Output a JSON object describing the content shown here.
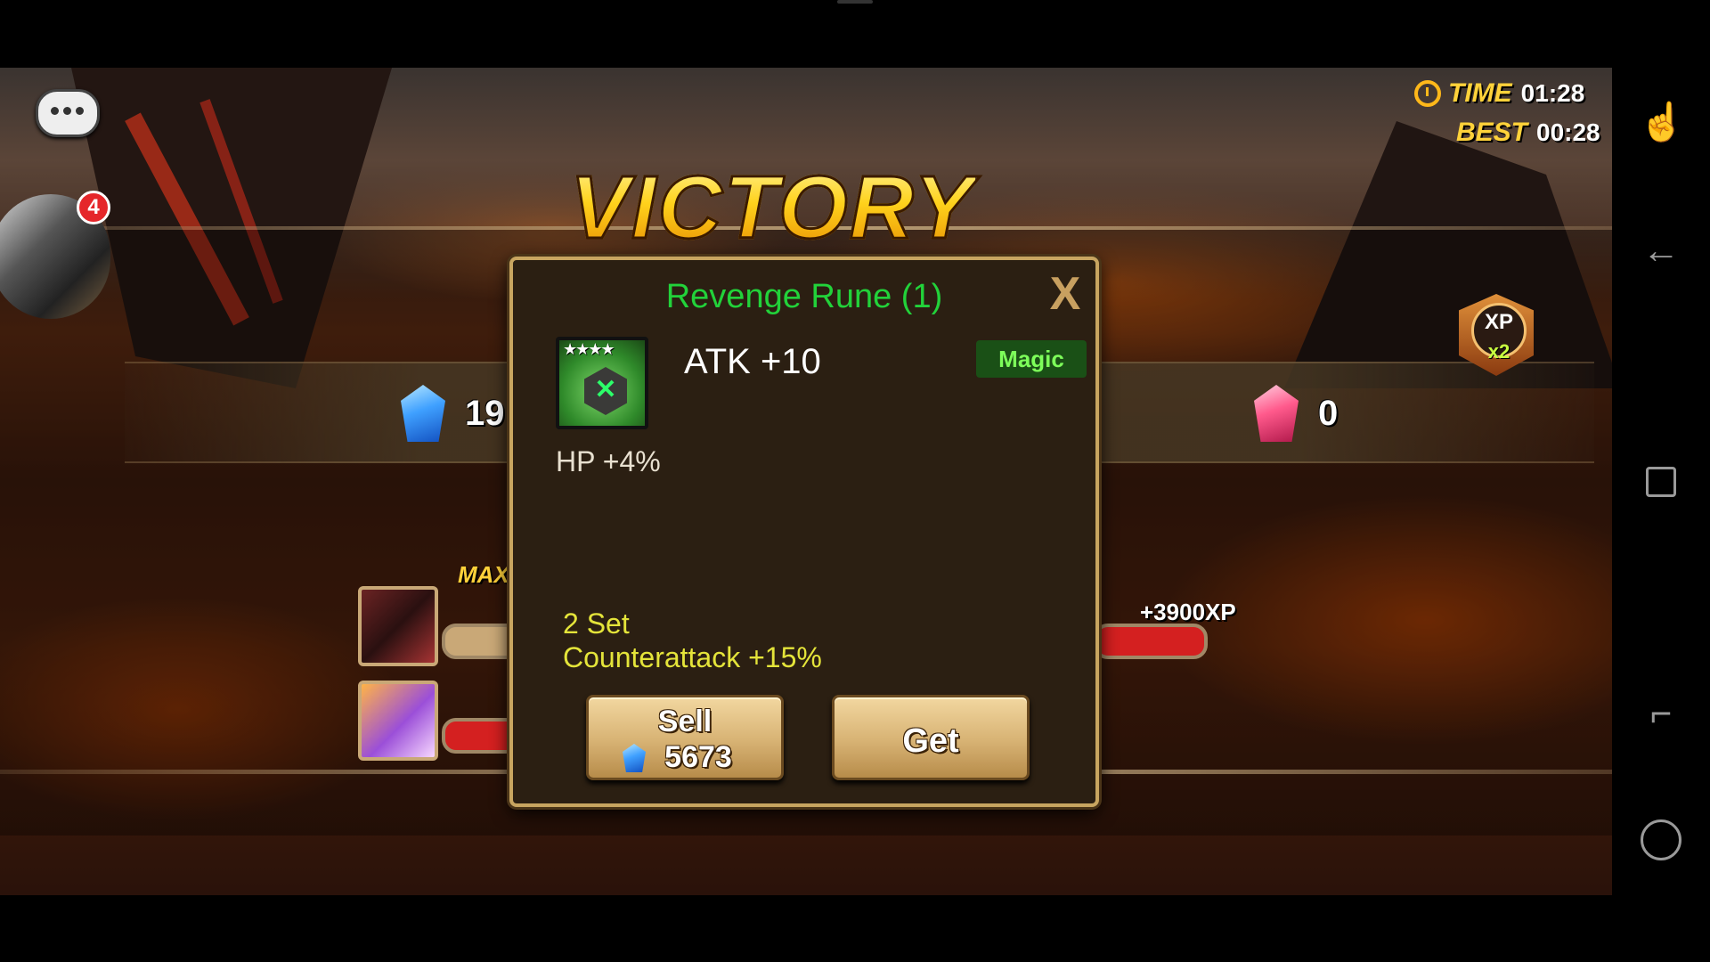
{
  "battle": {
    "title": "VICTORY",
    "timer": {
      "time_label": "TIME",
      "time_value": "01:28",
      "best_label": "BEST",
      "best_value": "00:28"
    },
    "xp_boost": {
      "label": "XP",
      "multiplier": "x2"
    },
    "rewards": {
      "crystals": "19",
      "other": "0"
    },
    "max_label": "MAX",
    "xp_gain": "+3900XP",
    "notifications": "4"
  },
  "rune_dialog": {
    "title": "Revenge Rune (1)",
    "close_label": "X",
    "stars": "★★★★",
    "main_stat": "ATK +10",
    "grade": "Magic",
    "sub_stats": [
      "HP +4%"
    ],
    "set_count": "2 Set",
    "set_bonus": "Counterattack +15%",
    "sell_label": "Sell",
    "sell_price": "5673",
    "get_label": "Get"
  },
  "colors": {
    "title_green": "#22d23a",
    "grade_green": "#7dff5a",
    "set_yellow": "#e4e43a",
    "victory_gold": "#ffcf2a",
    "frame_gold": "#c8a560"
  },
  "icons": [
    "chat-icon",
    "clock-icon",
    "crystal-icon",
    "pink-crystal-icon",
    "touch-icon",
    "back-icon",
    "recents-icon",
    "split-screen-icon",
    "game-tools-icon"
  ]
}
